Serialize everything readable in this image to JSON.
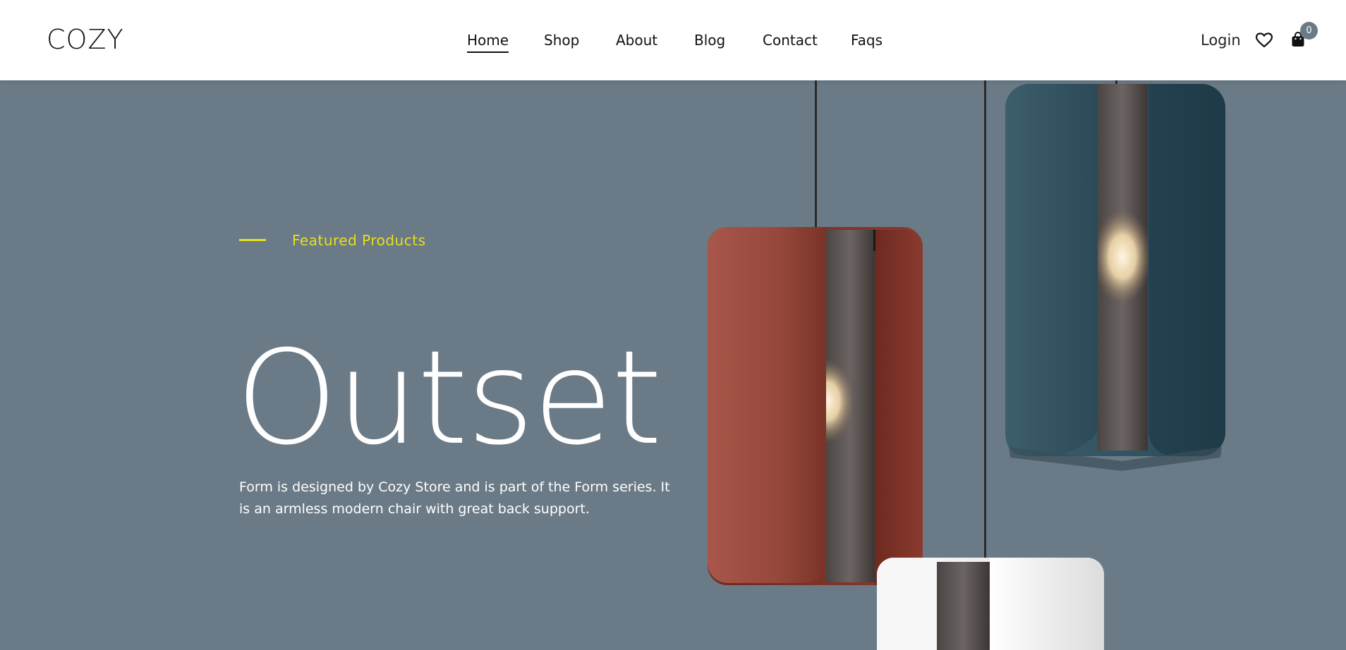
{
  "header": {
    "logo": "COZY",
    "nav": [
      {
        "label": "Home",
        "active": true
      },
      {
        "label": "Shop",
        "active": false
      },
      {
        "label": "About",
        "active": false
      },
      {
        "label": "Blog",
        "active": false
      },
      {
        "label": "Contact",
        "active": false
      },
      {
        "label": "Faqs",
        "active": false
      }
    ],
    "login_label": "Login",
    "cart_count": "0",
    "icons": [
      "heart-icon",
      "shopping-bag-icon"
    ]
  },
  "hero": {
    "tagline": "Featured Products",
    "title": "Outset",
    "description": "Form is designed by Cozy Store and is part of the Form series. It is an armless modern chair with great back support."
  },
  "colors": {
    "hero_bg": "#6a7b87",
    "accent": "#e8df1e",
    "lamp_red": "#9a4a3d",
    "lamp_blue": "#2f4f5e",
    "lamp_white": "#f2f2f2"
  }
}
